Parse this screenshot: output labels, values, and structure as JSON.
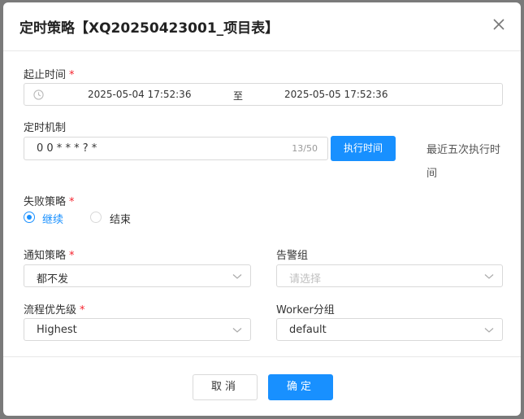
{
  "dialog": {
    "title": "定时策略【XQ20250423001_项目表】"
  },
  "time_range": {
    "label": "起止时间",
    "start": "2025-05-04 17:52:36",
    "separator": "至",
    "end": "2025-05-05 17:52:36"
  },
  "cron": {
    "label": "定时机制",
    "value": "0 0 * * * ? *",
    "count": "13/50",
    "exec_button": "执行时间",
    "recent_label": "最近五次执行时间"
  },
  "failure": {
    "label": "失败策略",
    "options": [
      "继续",
      "结束"
    ],
    "selected": "继续"
  },
  "notify": {
    "label": "通知策略",
    "value": "都不发"
  },
  "alarm_group": {
    "label": "告警组",
    "placeholder": "请选择"
  },
  "priority": {
    "label": "流程优先级",
    "value": "Highest"
  },
  "worker_group": {
    "label": "Worker分组",
    "value": "default"
  },
  "footer": {
    "cancel": "取消",
    "ok": "确定"
  },
  "colors": {
    "primary": "#1890ff",
    "required": "#f5222d"
  }
}
